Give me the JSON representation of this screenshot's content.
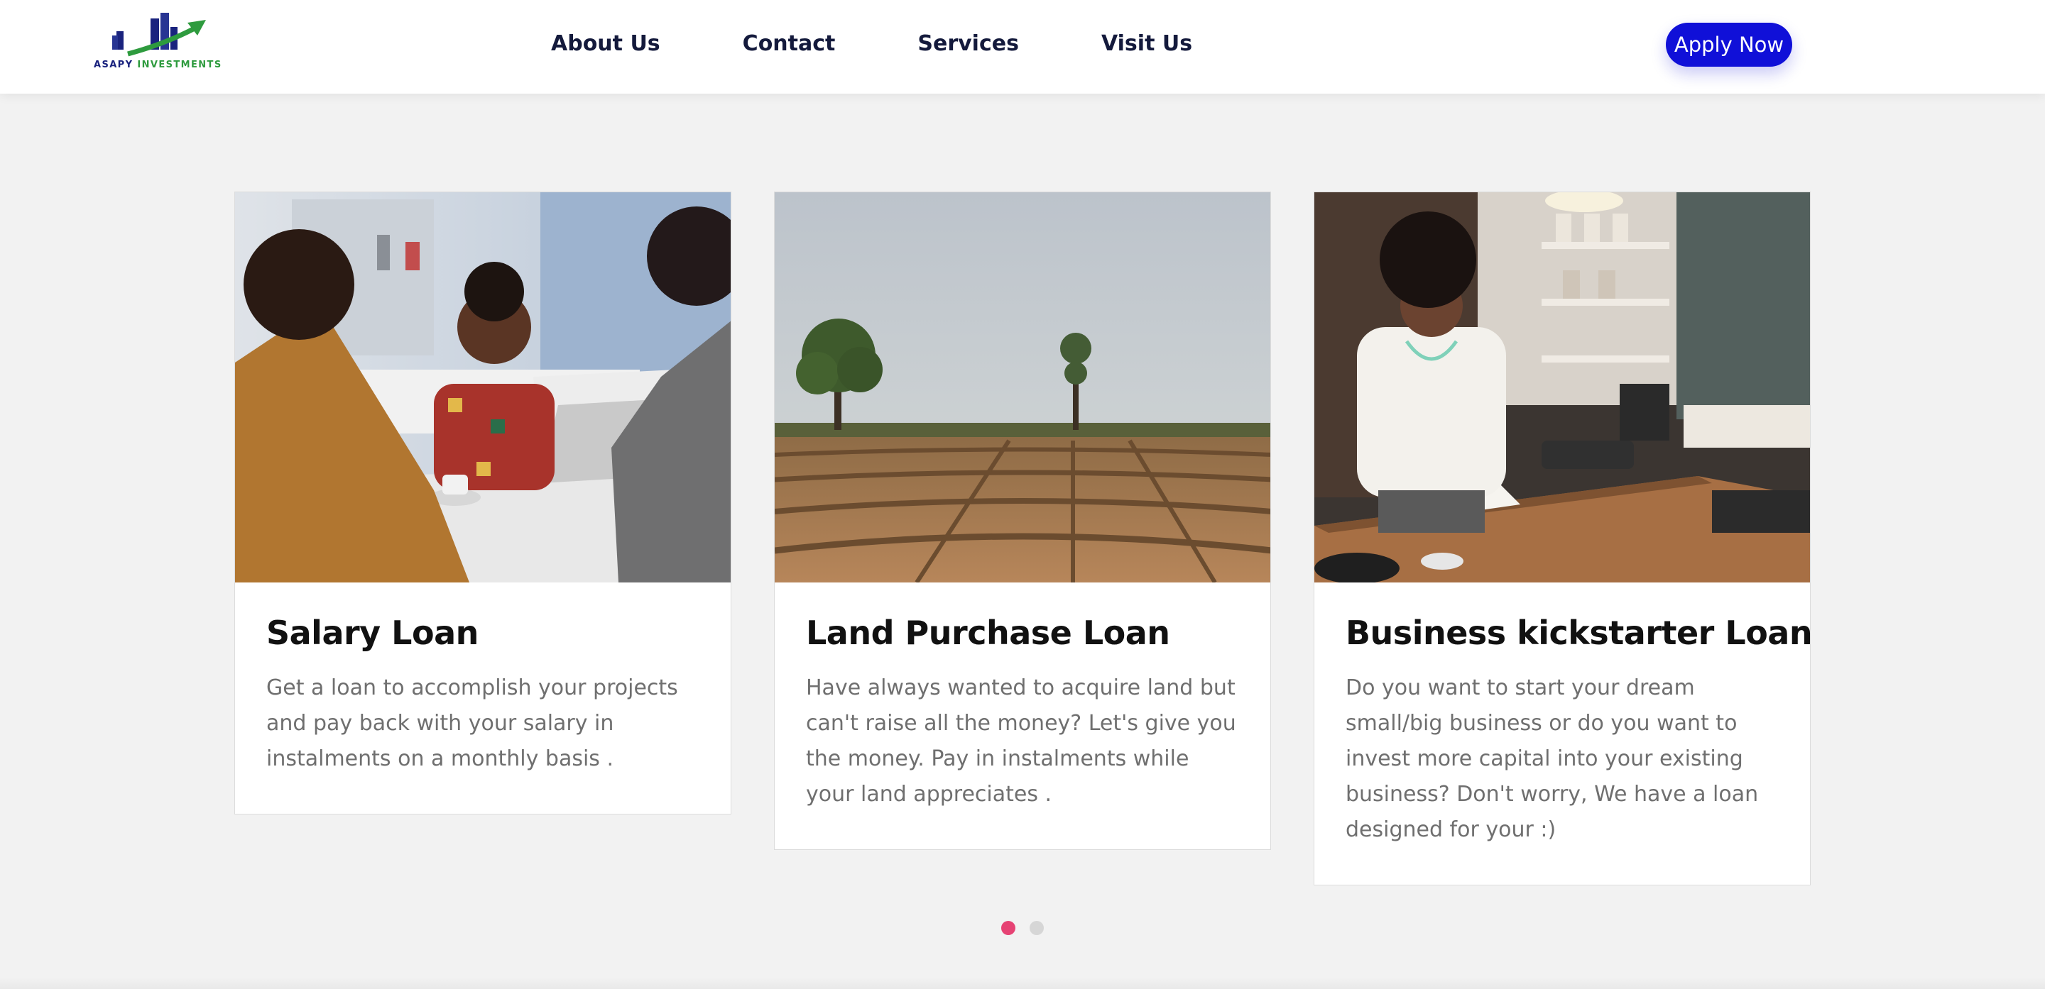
{
  "brand": {
    "logo_word1": "ASAPY",
    "logo_word2": "INVESTMENTS",
    "color_primary": "#1a237e",
    "color_accent": "#2e9b3e"
  },
  "nav": {
    "items": [
      {
        "label": "About Us"
      },
      {
        "label": "Contact"
      },
      {
        "label": "Services"
      },
      {
        "label": "Visit Us"
      }
    ],
    "apply_label": "Apply Now",
    "apply_color": "#1010d8"
  },
  "cards": [
    {
      "title": "Salary Loan",
      "text": "Get a loan to accomplish your projects and pay back with your salary in instalments on a monthly basis .",
      "image": "office-meeting-photo"
    },
    {
      "title": "Land Purchase Loan",
      "text": "Have always wanted to acquire land but can't raise all the money? Let's give you the money. Pay in instalments while your land appreciates .",
      "image": "farmland-photo"
    },
    {
      "title": "Business kickstarter Loan",
      "text": "Do you want to start your dream small/big business or do you want to invest more capital into your existing business? Don't worry, We have a loan designed for your :)",
      "image": "shop-owner-photo"
    }
  ],
  "carousel": {
    "pages": 2,
    "active": 1,
    "active_color": "#e64374"
  }
}
